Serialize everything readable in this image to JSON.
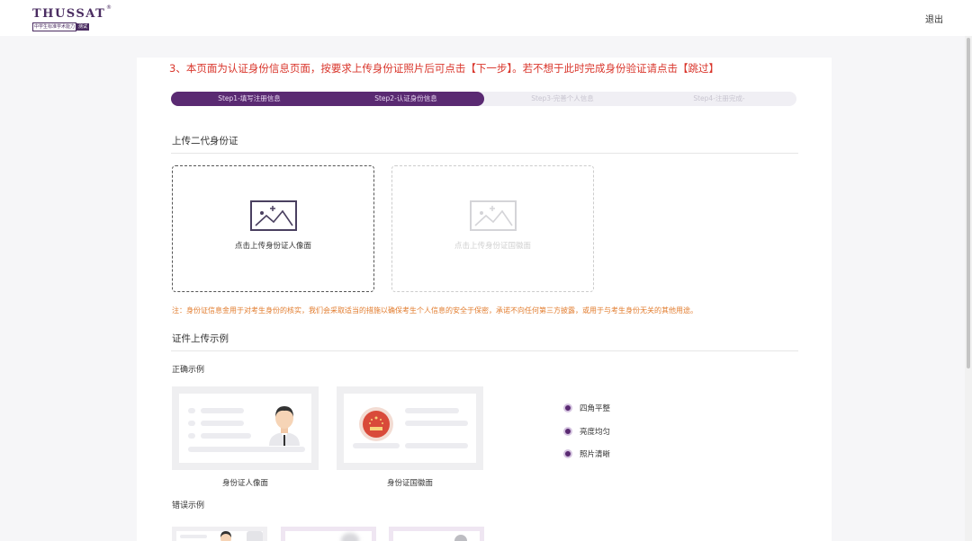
{
  "header": {
    "logo_text": "THUSSAT",
    "logo_reg": "®",
    "logo_sub": "中学生标准学术能力",
    "logo_badge": "测试",
    "logout": "退出"
  },
  "notice": "3、本页面为认证身份信息页面，按要求上传身份证照片后可点击【下一步】。若不想于此时完成身份验证请点击【跳过】",
  "progress": {
    "current_step": 2,
    "total_steps": 4,
    "steps": [
      {
        "label": "Step1-填写注册信息"
      },
      {
        "label": "Step2-认证身份信息"
      },
      {
        "label": "Step3-完善个人信息"
      },
      {
        "label": "Step4-注册完成-"
      }
    ]
  },
  "upload_section": {
    "title": "上传二代身份证",
    "front_label": "点击上传身份证人像面",
    "back_label": "点击上传身份证国徽面",
    "note": "注：身份证信息金用于对考生身份的核实，我们会采取适当的措施以确保考生个人信息的安全于保密，承诺不向任何第三方披露，或用于与考生身份无关的其他用途。"
  },
  "examples": {
    "title": "证件上传示例",
    "correct_label": "正确示例",
    "portrait_caption": "身份证人像面",
    "emblem_caption": "身份证国徽面",
    "checks": [
      "四角平整",
      "亮度均匀",
      "照片清晰"
    ],
    "wrong_label": "错误示例"
  },
  "colors": {
    "brand": "#5a2a72",
    "notice": "#d9352b",
    "note": "#e27c2e"
  }
}
